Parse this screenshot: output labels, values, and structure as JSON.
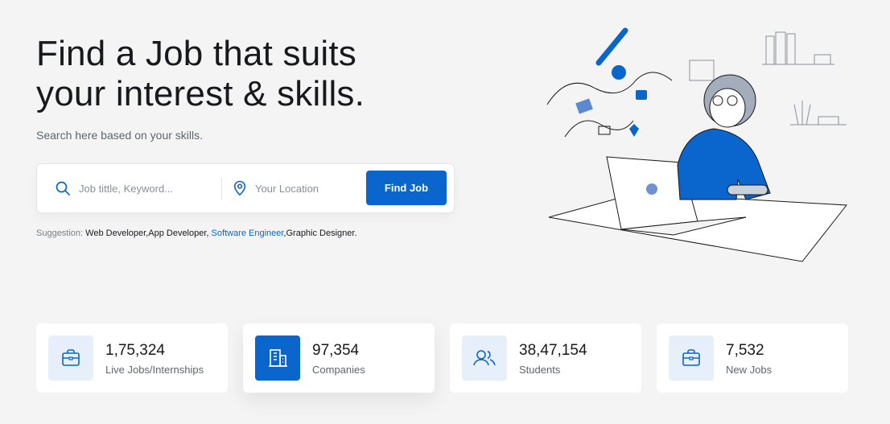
{
  "hero": {
    "headline_line1": "Find a Job that suits",
    "headline_line2": "your interest & skills.",
    "subtitle": "Search here based on your skills."
  },
  "search": {
    "keyword_placeholder": "Job tittle, Keyword...",
    "keyword_value": "",
    "location_placeholder": "Your Location",
    "location_value": "",
    "button_label": "Find Job"
  },
  "suggestion": {
    "label": "Suggestion:",
    "items": [
      "Web Developer,",
      "App Developer,",
      "Software Engineer",
      ",Graphic Designer."
    ],
    "highlighted": "Software Engineer"
  },
  "stats": [
    {
      "value": "1,75,324",
      "label": "Live Jobs/Internships",
      "icon": "briefcase-icon"
    },
    {
      "value": "97,354",
      "label": "Companies",
      "icon": "building-icon"
    },
    {
      "value": "38,47,154",
      "label": "Students",
      "icon": "users-icon"
    },
    {
      "value": "7,532",
      "label": "New Jobs",
      "icon": "briefcase-icon"
    }
  ],
  "colors": {
    "primary": "#0a65cc",
    "icon_bg": "#e7f0fa",
    "text": "#18191c",
    "muted": "#5e6670",
    "background": "#f4f4f5"
  }
}
